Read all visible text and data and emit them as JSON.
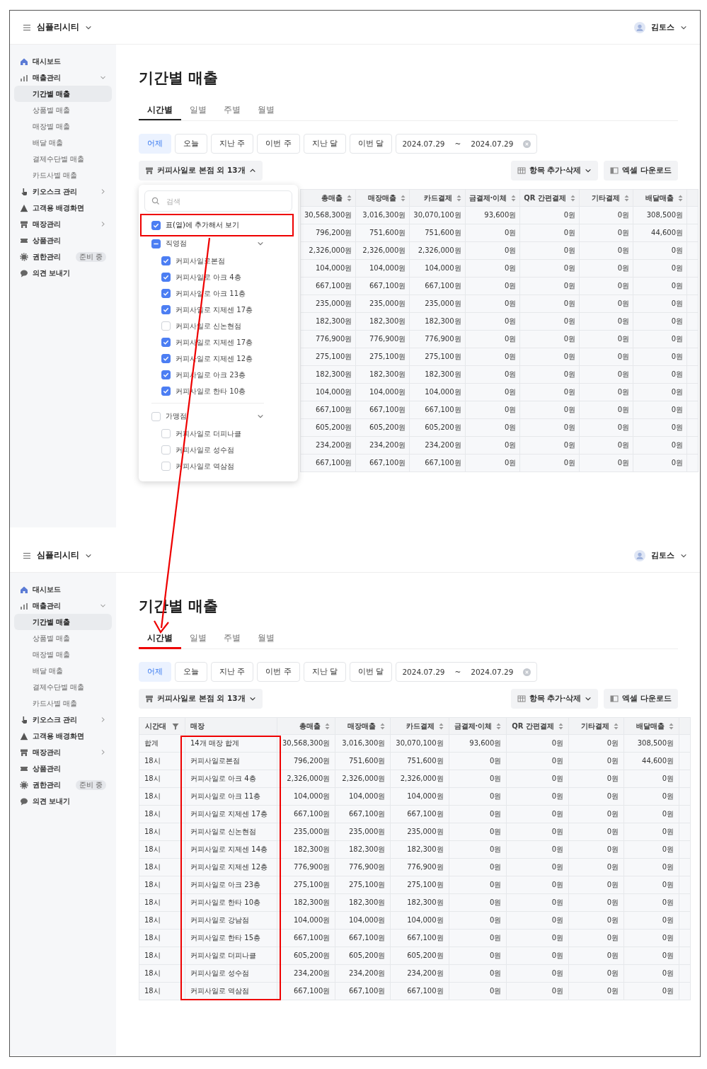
{
  "panels": [
    {
      "header": {
        "brand": "심플리시티",
        "user": "김토스"
      },
      "sidebar": {
        "items": [
          {
            "label": "대시보드"
          },
          {
            "label": "매출관리",
            "expanded": true,
            "children": [
              {
                "label": "기간별 매출",
                "selected": true
              },
              {
                "label": "상품별 매출",
                "selected": false
              },
              {
                "label": "매장별 매출",
                "selected": false
              },
              {
                "label": "배달 매출",
                "selected": false
              },
              {
                "label": "결제수단별 매출",
                "selected": false
              },
              {
                "label": "카드사별 매출",
                "selected": false
              }
            ]
          },
          {
            "label": "키오스크 관리",
            "expanded": false
          },
          {
            "label": "고객용 배경화면"
          },
          {
            "label": "매장관리",
            "expanded": false
          },
          {
            "label": "상품관리"
          },
          {
            "label": "권한관리",
            "badge": "준비 중"
          },
          {
            "label": "의견 보내기"
          }
        ]
      },
      "title": "기간별 매출",
      "tabs": [
        {
          "label": "시간별",
          "selected": true
        },
        {
          "label": "일별",
          "selected": false
        },
        {
          "label": "주별",
          "selected": false
        },
        {
          "label": "월별",
          "selected": false
        }
      ],
      "range_buttons": [
        {
          "label": "어제",
          "selected": true
        },
        {
          "label": "오늘",
          "selected": false
        },
        {
          "label": "지난 주",
          "selected": false
        },
        {
          "label": "이번 주",
          "selected": false
        },
        {
          "label": "지난 달",
          "selected": false
        },
        {
          "label": "이번 달",
          "selected": false
        }
      ],
      "date_range": {
        "from": "2024.07.29",
        "separator": "~",
        "to": "2024.07.29"
      },
      "store_filter": {
        "label": "커피사일로 본점 외 13개",
        "expanded": true
      },
      "actions": [
        {
          "label": "항목 추가·삭제"
        },
        {
          "label": "엑셀 다운로드"
        }
      ],
      "store_menu": {
        "search_placeholder": "검색",
        "show_in_table": {
          "label": "표(열)에 추가해서 보기",
          "checked": true
        },
        "groups": [
          {
            "label": "직영점",
            "checked": false,
            "partial": true,
            "expanded": true,
            "stores": [
              {
                "label": "커피사일로본점",
                "checked": true
              },
              {
                "label": "커피사일로 아크 4층",
                "checked": true
              },
              {
                "label": "커피사일로 아크 11층",
                "checked": true
              },
              {
                "label": "커피사일로 지제센 17층",
                "checked": true
              },
              {
                "label": "커피사일로 신논현점",
                "checked": false
              },
              {
                "label": "커피사일로 지제센 17층",
                "checked": true
              },
              {
                "label": "커피사일로 지제센 12층",
                "checked": true
              },
              {
                "label": "커피사일로 아크 23층",
                "checked": true
              },
              {
                "label": "커피사일로 한타 10층",
                "checked": true
              }
            ]
          },
          {
            "label": "가맹점",
            "checked": false,
            "partial": false,
            "expanded": true,
            "stores": [
              {
                "label": "커피사일로 더피나클",
                "checked": false
              },
              {
                "label": "커피사일로 성수점",
                "checked": false
              },
              {
                "label": "커피사일로 역삼점",
                "checked": false
              }
            ]
          }
        ]
      },
      "table": {
        "columns": [
          {
            "label": "총매출",
            "kind": "sort"
          },
          {
            "label": "매장매출",
            "kind": "sort"
          },
          {
            "label": "카드결제",
            "kind": "sort"
          },
          {
            "label": "금결제·이체",
            "kind": "sort"
          },
          {
            "label": "QR 간편결제",
            "kind": "sort"
          },
          {
            "label": "기타결제",
            "kind": "sort"
          },
          {
            "label": "배달매출",
            "kind": "sort"
          }
        ],
        "rows": [
          [
            "30,568,300원",
            "3,016,300원",
            "30,070,100원",
            "93,600원",
            "0원",
            "0원",
            "308,500원"
          ],
          [
            "796,200원",
            "751,600원",
            "751,600원",
            "0원",
            "0원",
            "0원",
            "44,600원"
          ],
          [
            "2,326,000원",
            "2,326,000원",
            "2,326,000원",
            "0원",
            "0원",
            "0원",
            "0원"
          ],
          [
            "104,000원",
            "104,000원",
            "104,000원",
            "0원",
            "0원",
            "0원",
            "0원"
          ],
          [
            "667,100원",
            "667,100원",
            "667,100원",
            "0원",
            "0원",
            "0원",
            "0원"
          ],
          [
            "235,000원",
            "235,000원",
            "235,000원",
            "0원",
            "0원",
            "0원",
            "0원"
          ],
          [
            "182,300원",
            "182,300원",
            "182,300원",
            "0원",
            "0원",
            "0원",
            "0원"
          ],
          [
            "776,900원",
            "776,900원",
            "776,900원",
            "0원",
            "0원",
            "0원",
            "0원"
          ],
          [
            "275,100원",
            "275,100원",
            "275,100원",
            "0원",
            "0원",
            "0원",
            "0원"
          ],
          [
            "182,300원",
            "182,300원",
            "182,300원",
            "0원",
            "0원",
            "0원",
            "0원"
          ],
          [
            "104,000원",
            "104,000원",
            "104,000원",
            "0원",
            "0원",
            "0원",
            "0원"
          ],
          [
            "667,100원",
            "667,100원",
            "667,100원",
            "0원",
            "0원",
            "0원",
            "0원"
          ],
          [
            "605,200원",
            "605,200원",
            "605,200원",
            "0원",
            "0원",
            "0원",
            "0원"
          ],
          [
            "234,200원",
            "234,200원",
            "234,200원",
            "0원",
            "0원",
            "0원",
            "0원"
          ],
          [
            "667,100원",
            "667,100원",
            "667,100원",
            "0원",
            "0원",
            "0원",
            "0원"
          ]
        ]
      }
    },
    {
      "header": {
        "brand": "심플리시티",
        "user": "김토스"
      },
      "sidebar": {
        "items": [
          {
            "label": "대시보드"
          },
          {
            "label": "매출관리",
            "expanded": true,
            "children": [
              {
                "label": "기간별 매출",
                "selected": true
              },
              {
                "label": "상품별 매출",
                "selected": false
              },
              {
                "label": "매장별 매출",
                "selected": false
              },
              {
                "label": "배달 매출",
                "selected": false
              },
              {
                "label": "결제수단별 매출",
                "selected": false
              },
              {
                "label": "카드사별 매출",
                "selected": false
              }
            ]
          },
          {
            "label": "키오스크 관리",
            "expanded": false
          },
          {
            "label": "고객용 배경화면"
          },
          {
            "label": "매장관리",
            "expanded": false
          },
          {
            "label": "상품관리"
          },
          {
            "label": "권한관리",
            "badge": "준비 중"
          },
          {
            "label": "의견 보내기"
          }
        ]
      },
      "title": "기간별 매출",
      "tabs": [
        {
          "label": "시간별",
          "selected": true
        },
        {
          "label": "일별",
          "selected": false
        },
        {
          "label": "주별",
          "selected": false
        },
        {
          "label": "월별",
          "selected": false
        }
      ],
      "range_buttons": [
        {
          "label": "어제",
          "selected": true
        },
        {
          "label": "오늘",
          "selected": false
        },
        {
          "label": "지난 주",
          "selected": false
        },
        {
          "label": "이번 주",
          "selected": false
        },
        {
          "label": "지난 달",
          "selected": false
        },
        {
          "label": "이번 달",
          "selected": false
        }
      ],
      "date_range": {
        "from": "2024.07.29",
        "separator": "~",
        "to": "2024.07.29"
      },
      "store_filter": {
        "label": "커피사일로 본점 외 13개",
        "expanded": false
      },
      "actions": [
        {
          "label": "항목 추가·삭제"
        },
        {
          "label": "엑셀 다운로드"
        }
      ],
      "table": {
        "columns": [
          {
            "label": "시간대",
            "kind": "filter"
          },
          {
            "label": "매장",
            "kind": "plain"
          },
          {
            "label": "총매출",
            "kind": "sort"
          },
          {
            "label": "매장매출",
            "kind": "sort"
          },
          {
            "label": "카드결제",
            "kind": "sort"
          },
          {
            "label": "금결제·이체",
            "kind": "sort"
          },
          {
            "label": "QR 간편결제",
            "kind": "sort"
          },
          {
            "label": "기타결제",
            "kind": "sort"
          },
          {
            "label": "배달매출",
            "kind": "sort"
          }
        ],
        "rows": [
          [
            "합계",
            "14개 매장 합계",
            "30,568,300원",
            "3,016,300원",
            "30,070,100원",
            "93,600원",
            "0원",
            "0원",
            "308,500원"
          ],
          [
            "18시",
            "커피사일로본점",
            "796,200원",
            "751,600원",
            "751,600원",
            "0원",
            "0원",
            "0원",
            "44,600원"
          ],
          [
            "18시",
            "커피사일로 아크 4층",
            "2,326,000원",
            "2,326,000원",
            "2,326,000원",
            "0원",
            "0원",
            "0원",
            "0원"
          ],
          [
            "18시",
            "커피사일로 아크 11층",
            "104,000원",
            "104,000원",
            "104,000원",
            "0원",
            "0원",
            "0원",
            "0원"
          ],
          [
            "18시",
            "커피사일로 지제센 17층",
            "667,100원",
            "667,100원",
            "667,100원",
            "0원",
            "0원",
            "0원",
            "0원"
          ],
          [
            "18시",
            "커피사일로 신논현점",
            "235,000원",
            "235,000원",
            "235,000원",
            "0원",
            "0원",
            "0원",
            "0원"
          ],
          [
            "18시",
            "커피사일로 지제센 14층",
            "182,300원",
            "182,300원",
            "182,300원",
            "0원",
            "0원",
            "0원",
            "0원"
          ],
          [
            "18시",
            "커피사일로 지제센 12층",
            "776,900원",
            "776,900원",
            "776,900원",
            "0원",
            "0원",
            "0원",
            "0원"
          ],
          [
            "18시",
            "커피사일로 아크 23층",
            "275,100원",
            "275,100원",
            "275,100원",
            "0원",
            "0원",
            "0원",
            "0원"
          ],
          [
            "18시",
            "커피사일로 한타 10층",
            "182,300원",
            "182,300원",
            "182,300원",
            "0원",
            "0원",
            "0원",
            "0원"
          ],
          [
            "18시",
            "커피사일로 강남점",
            "104,000원",
            "104,000원",
            "104,000원",
            "0원",
            "0원",
            "0원",
            "0원"
          ],
          [
            "18시",
            "커피사일로 한타 15층",
            "667,100원",
            "667,100원",
            "667,100원",
            "0원",
            "0원",
            "0원",
            "0원"
          ],
          [
            "18시",
            "커피사일로 더피나클",
            "605,200원",
            "605,200원",
            "605,200원",
            "0원",
            "0원",
            "0원",
            "0원"
          ],
          [
            "18시",
            "커피사일로 성수점",
            "234,200원",
            "234,200원",
            "234,200원",
            "0원",
            "0원",
            "0원",
            "0원"
          ],
          [
            "18시",
            "커피사일로 역삼점",
            "667,100원",
            "667,100원",
            "667,100원",
            "0원",
            "0원",
            "0원",
            "0원"
          ]
        ]
      }
    }
  ]
}
